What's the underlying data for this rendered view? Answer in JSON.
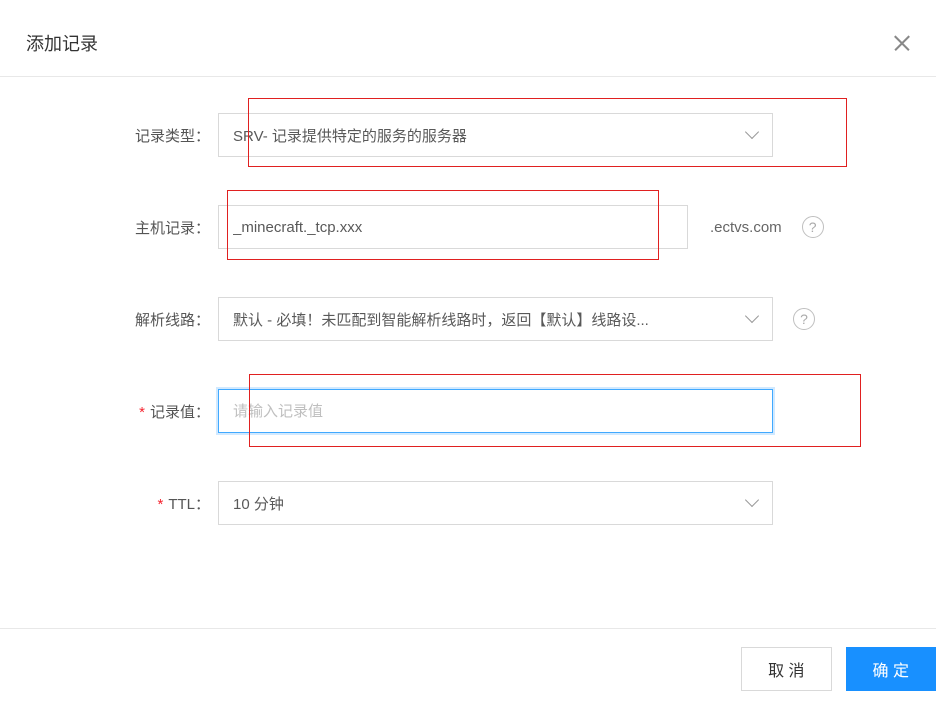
{
  "modal": {
    "title": "添加记录"
  },
  "form": {
    "record_type": {
      "label": "记录类型：",
      "selected": "SRV- 记录提供特定的服务的服务器"
    },
    "host_record": {
      "label": "主机记录：",
      "value": "_minecraft._tcp.xxx",
      "suffix": ".ectvs.com"
    },
    "resolution_route": {
      "label": "解析线路：",
      "selected": "默认 - 必填！未匹配到智能解析线路时，返回【默认】线路设..."
    },
    "record_value": {
      "label": "记录值：",
      "placeholder": "请输入记录值"
    },
    "ttl": {
      "label": "TTL：",
      "selected": "10 分钟"
    }
  },
  "footer": {
    "cancel": "取 消",
    "confirm": "确 定"
  },
  "icons": {
    "help": "?"
  }
}
